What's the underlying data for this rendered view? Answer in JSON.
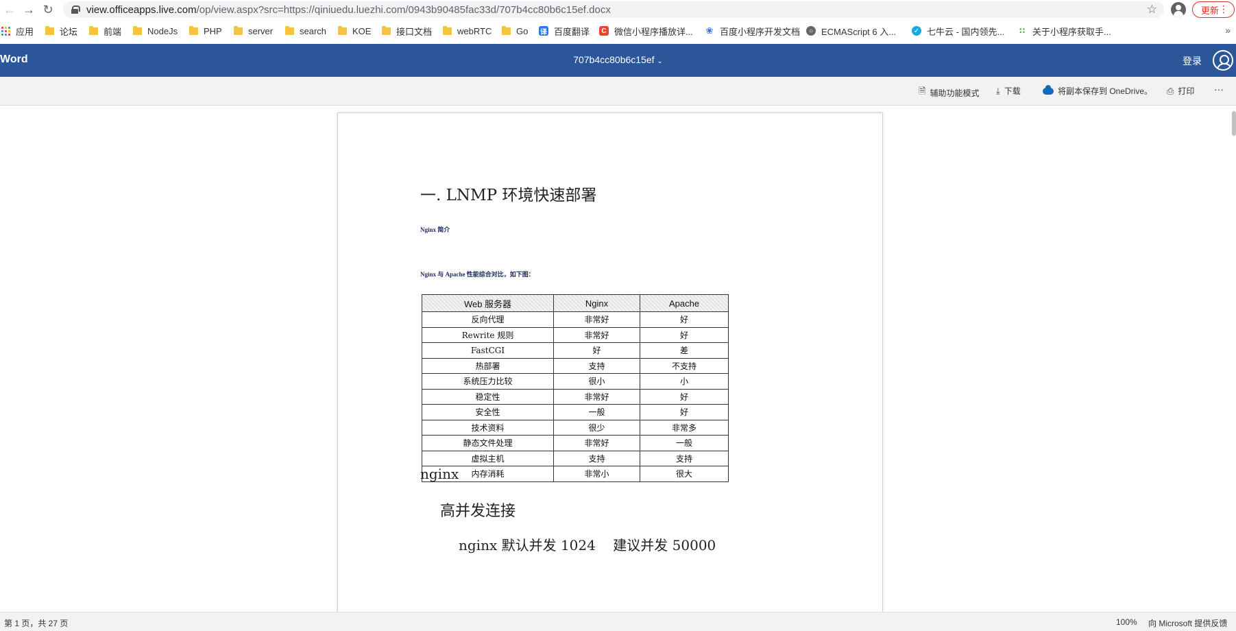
{
  "browser": {
    "url_host": "view.officeapps.live.com",
    "url_path": "/op/view.aspx?src=https://qiniuedu.luezhi.com/0943b90485fac33d/707b4cc80b6c15ef.docx",
    "update_label": "更新"
  },
  "bookmarks": [
    {
      "label": "应用",
      "icon": "apps-grid-icon"
    },
    {
      "label": "论坛",
      "icon": "folder-icon"
    },
    {
      "label": "前端",
      "icon": "folder-icon"
    },
    {
      "label": "NodeJs",
      "icon": "folder-icon"
    },
    {
      "label": "PHP",
      "icon": "folder-icon"
    },
    {
      "label": "server",
      "icon": "folder-icon"
    },
    {
      "label": "search",
      "icon": "folder-icon"
    },
    {
      "label": "KOE",
      "icon": "folder-icon"
    },
    {
      "label": "接口文档",
      "icon": "folder-icon"
    },
    {
      "label": "webRTC",
      "icon": "folder-icon"
    },
    {
      "label": "Go",
      "icon": "folder-icon"
    },
    {
      "label": "百度翻译",
      "icon": "baidu-translate-icon",
      "color": "#2878f0"
    },
    {
      "label": "微信小程序播放详...",
      "icon": "csdn-icon",
      "color": "#e8452e"
    },
    {
      "label": "百度小程序开发文档",
      "icon": "baidu-paw-icon",
      "color": "#2b6de4"
    },
    {
      "label": "ECMAScript 6 入...",
      "icon": "globe-icon",
      "color": "#555555"
    },
    {
      "label": "七牛云 - 国内领先...",
      "icon": "qiniu-icon",
      "color": "#19a7e6"
    },
    {
      "label": "关于小程序获取手...",
      "icon": "dots-grid-icon",
      "color": "#4caf50"
    }
  ],
  "word": {
    "brand": "Word",
    "doc_title": "707b4cc80b6c15ef",
    "signin": "登录",
    "accent": "#2b579a"
  },
  "commands": {
    "accessibility": "辅助功能模式",
    "download": "下载",
    "save_copy": "将副本保存到 OneDrive。",
    "print": "打印",
    "more": "···"
  },
  "document": {
    "heading": "一. LNMP 环境快速部署",
    "note1": "Nginx 简介",
    "note2": "Nginx 与 Apache 性能综合对比，如下图：",
    "table": {
      "headers": [
        "Web 服务器",
        "Nginx",
        "Apache"
      ],
      "rows": [
        [
          "反向代理",
          "非常好",
          "好"
        ],
        [
          "Rewrite 规则",
          "非常好",
          "好"
        ],
        [
          "FastCGI",
          "好",
          "差"
        ],
        [
          "热部署",
          "支持",
          "不支持"
        ],
        [
          "系统压力比较",
          "很小",
          "小"
        ],
        [
          "稳定性",
          "非常好",
          "好"
        ],
        [
          "安全性",
          "一般",
          "好"
        ],
        [
          "技术资料",
          "很少",
          "非常多"
        ],
        [
          "静态文件处理",
          "非常好",
          "一般"
        ],
        [
          "虚拟主机",
          "支持",
          "支持"
        ],
        [
          "内存消耗",
          "非常小",
          "很大"
        ]
      ]
    },
    "line1": "nginx",
    "line2": "高并发连接",
    "line3": "nginx 默认并发 1024    建议并发 50000"
  },
  "status": {
    "pages": "第 1 页，共 27 页",
    "zoom": "100%",
    "feedback": "向 Microsoft 提供反馈"
  }
}
